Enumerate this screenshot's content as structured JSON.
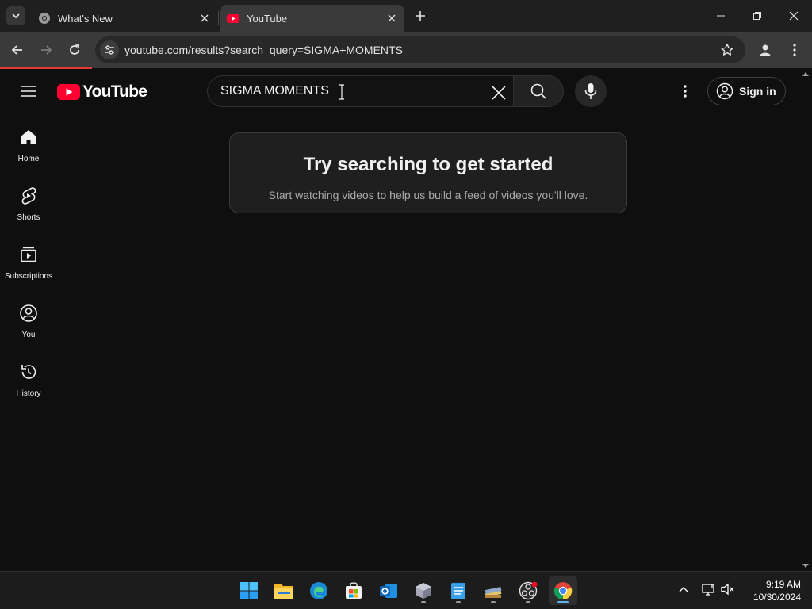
{
  "browser": {
    "tabs": [
      {
        "title": "What's New"
      },
      {
        "title": "YouTube"
      }
    ],
    "address_bar": {
      "url": "youtube.com/results?search_query=SIGMA+MOMENTS"
    }
  },
  "youtube": {
    "logo_text": "YouTube",
    "search": {
      "query": "SIGMA MOMENTS"
    },
    "sign_in_label": "Sign in",
    "sidebar": [
      {
        "label": "Home",
        "icon": "home-icon"
      },
      {
        "label": "Shorts",
        "icon": "shorts-icon"
      },
      {
        "label": "Subscriptions",
        "icon": "subscriptions-icon"
      },
      {
        "label": "You",
        "icon": "you-icon"
      },
      {
        "label": "History",
        "icon": "history-icon"
      }
    ],
    "empty_state": {
      "title": "Try searching to get started",
      "subtitle": "Start watching videos to help us build a feed of videos you'll love."
    }
  },
  "taskbar": {
    "apps": [
      "start",
      "file-explorer",
      "edge",
      "microsoft-store",
      "outlook",
      "virtualbox",
      "notepad",
      "winrar",
      "obs",
      "chrome"
    ],
    "clock": {
      "time": "9:19 AM",
      "date": "10/30/2024"
    }
  },
  "colors": {
    "youtube_red": "#ff0033",
    "chrome_dark": "#1f1f1f",
    "page_bg": "#0f0f0f",
    "accent_blue": "#5fb2f2"
  }
}
